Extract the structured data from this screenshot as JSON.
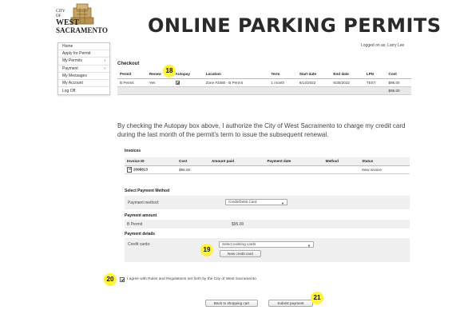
{
  "logo": {
    "line1": "CITY",
    "line2": "OF",
    "line3": "WEST",
    "line4": "SACRAMENTO"
  },
  "header": {
    "title": "ONLINE PARKING PERMITS",
    "logged_in": "Logged on as: Larry Lee"
  },
  "nav": {
    "items": [
      {
        "label": "Home",
        "arrow": ""
      },
      {
        "label": "Apply for Permit",
        "arrow": ""
      },
      {
        "label": "My Permits",
        "arrow": "›"
      },
      {
        "label": "Payment",
        "arrow": "›"
      },
      {
        "label": "My Messages",
        "arrow": ""
      },
      {
        "label": "My Account",
        "arrow": ""
      },
      {
        "label": "Log Off",
        "arrow": ""
      }
    ]
  },
  "checkout": {
    "heading": "Checkout",
    "columns": [
      "Permit",
      "Renew",
      "Autopay",
      "Location",
      "Term",
      "Start date",
      "End date",
      "LPN",
      "Cost"
    ],
    "row": {
      "permit": "B Permit",
      "renew": "Yes",
      "location": "Zone #3480 - B Permit",
      "term": "1 month",
      "start": "6/14/2022",
      "end": "6/30/2022",
      "lpn": "TEST",
      "cost": "$95.00"
    },
    "total": "$95.00"
  },
  "authorization": "By checking the Autopay box above, I authorize the City of West Sacramento to charge my credit card during the last month of the permit's term to issue the subsequent renewal.",
  "invoices": {
    "heading": "Invoices",
    "columns": [
      "Invoice ID",
      "Cost",
      "Amount paid",
      "Payment date",
      "Method",
      "Status"
    ],
    "row": {
      "id": "2098813",
      "cost": "$95.00",
      "amount_paid": "",
      "payment_date": "",
      "method": "",
      "status": "New invoice"
    }
  },
  "payment_method": {
    "heading": "Select Payment Method",
    "label": "Payment method:",
    "selected": "Credit/Debit Card"
  },
  "payment_amount": {
    "heading": "Payment amount",
    "label": "B Permit",
    "value": "$95.00"
  },
  "payment_details": {
    "heading": "Payment details",
    "label": "Credit cards:",
    "selected": "Select existing cards",
    "new_card_button": "New credit card"
  },
  "agreement": {
    "checked": true,
    "text": "I agree with Rules and Regulations set forth by the City of West Sacramento"
  },
  "actions": {
    "back": "Back to shopping cart",
    "submit": "Submit payment"
  },
  "badges": {
    "b18": "18",
    "b19": "19",
    "b20": "20",
    "b21": "21"
  },
  "colors": {
    "badge": "#fff33b",
    "band": "#f0f0f0",
    "border": "#c9c9c9"
  }
}
